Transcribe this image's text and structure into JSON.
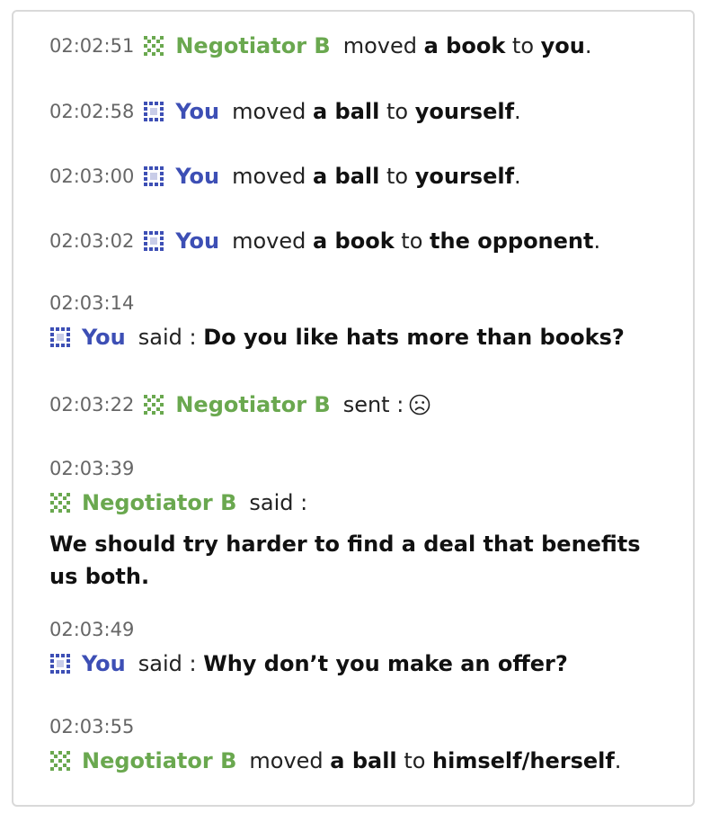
{
  "log": [
    {
      "time": "02:02:51",
      "actor": "Negotiator B",
      "verb": "moved",
      "item": "a book",
      "prep": "to",
      "target": "you",
      "end": "."
    },
    {
      "time": "02:02:58",
      "actor": "You",
      "verb": "moved",
      "item": "a ball",
      "prep": "to",
      "target": "yourself",
      "end": "."
    },
    {
      "time": "02:03:00",
      "actor": "You",
      "verb": "moved",
      "item": "a ball",
      "prep": "to",
      "target": "yourself",
      "end": "."
    },
    {
      "time": "02:03:02",
      "actor": "You",
      "verb": "moved",
      "item": "a book",
      "prep": "to",
      "target": "the opponent",
      "end": "."
    },
    {
      "time": "02:03:14",
      "actor": "You",
      "verb": "said :",
      "message": "Do you like hats more than books?"
    },
    {
      "time": "02:03:22",
      "actor": "Negotiator B",
      "verb": "sent :",
      "emoji": "sad-face-icon"
    },
    {
      "time": "02:03:39",
      "actor": "Negotiator B",
      "verb": "said :",
      "message": "We should try harder to find a deal that benefits us both."
    },
    {
      "time": "02:03:49",
      "actor": "You",
      "verb": "said :",
      "message": "Why don’t you make an offer?"
    },
    {
      "time": "02:03:55",
      "actor": "Negotiator B",
      "verb": "moved",
      "item": "a ball",
      "prep": "to",
      "target": "himself/herself",
      "end": "."
    }
  ],
  "colors": {
    "negotiator_b": "#6aa84f",
    "you": "#3d4fb5",
    "timestamp": "#666666"
  }
}
